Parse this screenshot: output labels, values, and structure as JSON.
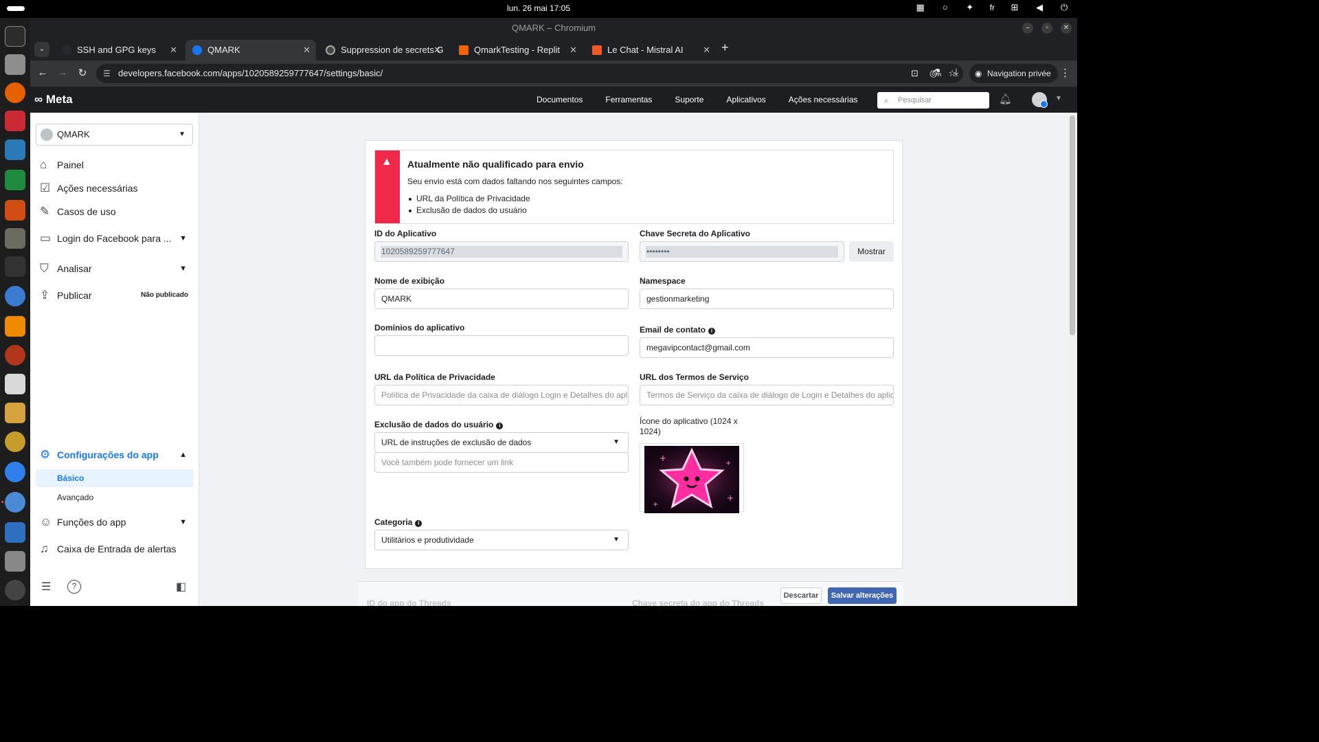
{
  "system": {
    "clock": "lun. 26 mai  17:05",
    "lang": "fr"
  },
  "browser": {
    "window_title": "QMARK – Chromium",
    "tabs": [
      {
        "label": "SSH and GPG keys"
      },
      {
        "label": "QMARK"
      },
      {
        "label": "Suppression de secrets G"
      },
      {
        "label": "QmarkTesting - Replit"
      },
      {
        "label": "Le Chat - Mistral AI"
      }
    ],
    "url": "developers.facebook.com/apps/1020589259777647/settings/basic/",
    "incognito_label": "Navigation privée"
  },
  "meta_header": {
    "logo": "Meta",
    "nav": [
      "Documentos",
      "Ferramentas",
      "Suporte",
      "Aplicativos",
      "Ações necessárias"
    ],
    "search_placeholder": "Pesquisar"
  },
  "sidebar": {
    "app_name": "QMARK",
    "items": {
      "painel": "Painel",
      "acoes": "Ações necessárias",
      "casos": "Casos de uso",
      "login": "Login do Facebook para ...",
      "analisar": "Analisar",
      "publicar": "Publicar",
      "publicar_badge": "Não publicado",
      "config": "Configurações do app",
      "basico": "Básico",
      "avancado": "Avançado",
      "funcoes": "Funções do app",
      "caixa": "Caixa de Entrada de alertas"
    }
  },
  "alert": {
    "title": "Atualmente não qualificado para envio",
    "text": "Seu envio está com dados faltando nos seguintes campos:",
    "items": [
      "URL da Política de Privacidade",
      "Exclusão de dados do usuário"
    ]
  },
  "form": {
    "app_id_label": "ID do Aplicativo",
    "app_id_value": "1020589259777647",
    "secret_label": "Chave Secreta do Aplicativo",
    "secret_value": "••••••••",
    "show_button": "Mostrar",
    "display_name_label": "Nome de exibição",
    "display_name_value": "QMARK",
    "namespace_label": "Namespace",
    "namespace_value": "gestionmarketing",
    "domains_label": "Domínios do aplicativo",
    "email_label": "Email de contato",
    "email_value": "megavipcontact@gmail.com",
    "privacy_label": "URL da Política de Privacidade",
    "privacy_placeholder": "Política de Privacidade da caixa de diálogo Login e Detalhes do aplicativo",
    "terms_label": "URL dos Termos de Serviço",
    "terms_placeholder": "Termos de Serviço da caixa de diálogo de Login e Detalhes do aplicativo",
    "deletion_label": "Exclusão de dados do usuário",
    "deletion_select": "URL de instruções de exclusão de dados",
    "deletion_placeholder": "Você também pode fornecer um link",
    "icon_label": "Ícone do aplicativo (1024 x 1024)",
    "category_label": "Categoria",
    "category_value": "Utilitários e produtividade"
  },
  "footer": {
    "threads_id_label": "ID do app do Threads",
    "threads_secret_label": "Chave secreta do app do Threads",
    "discard": "Descartar",
    "save": "Salvar alterações"
  },
  "colors": {
    "accent": "#1877f2",
    "alert_red": "#f02849",
    "save_button": "#4267b2"
  }
}
